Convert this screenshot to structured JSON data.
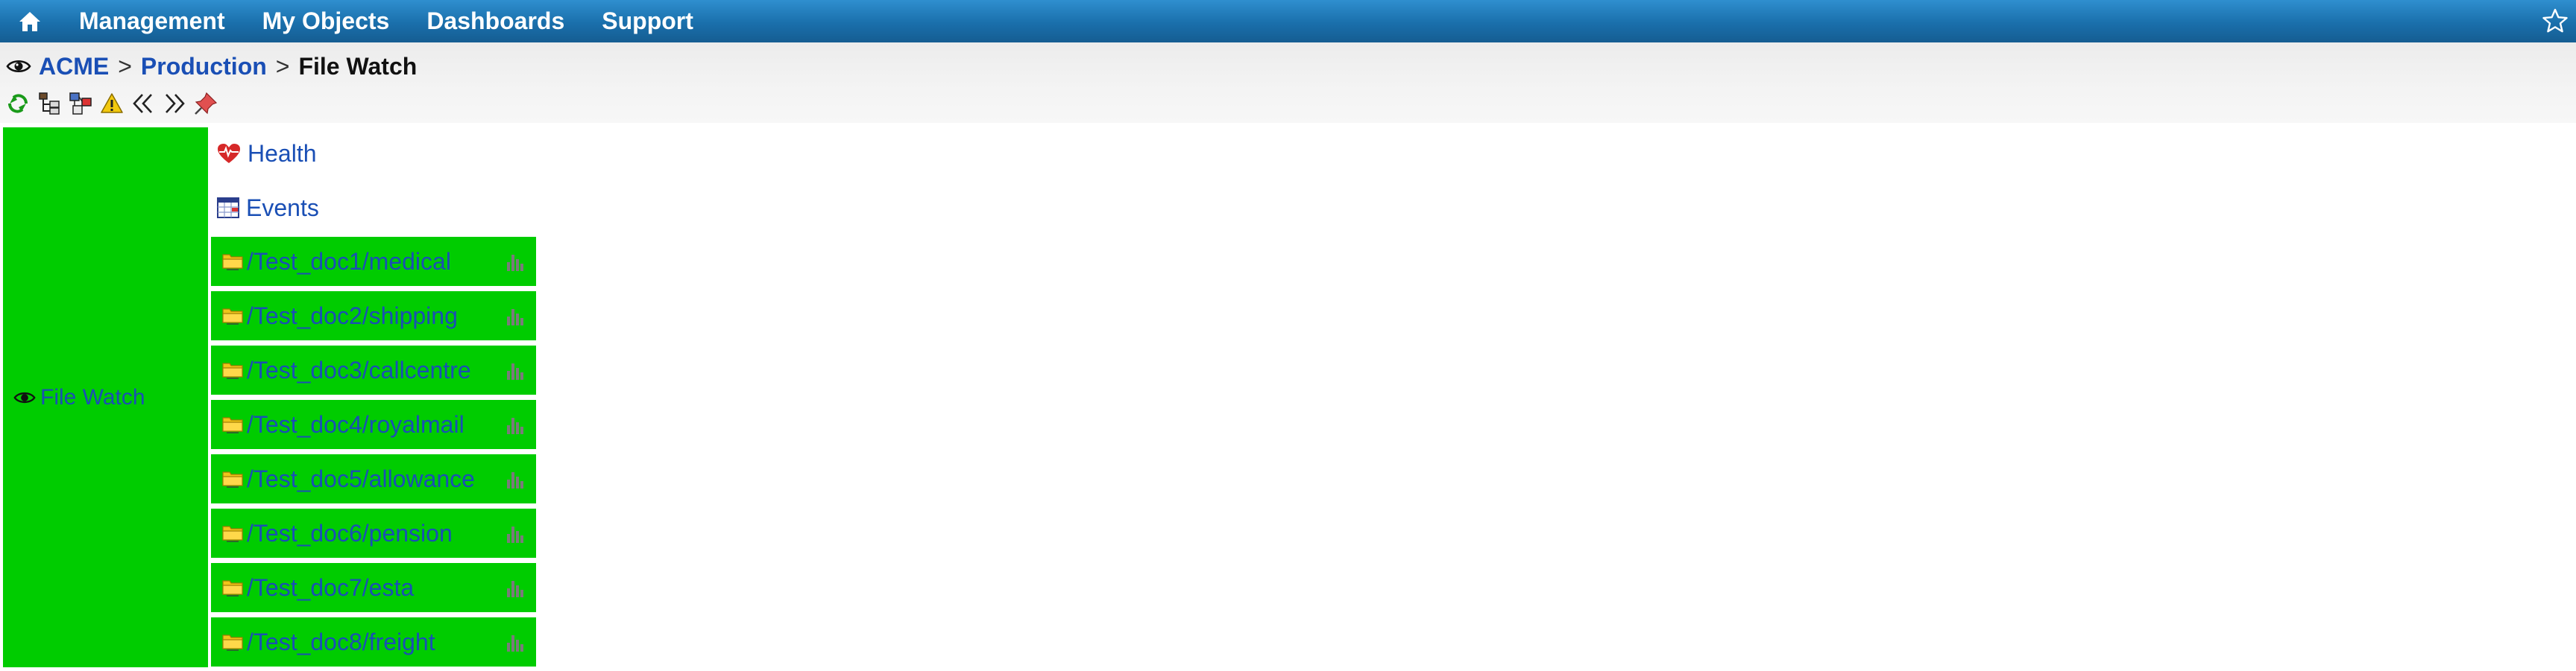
{
  "navbar": {
    "items": [
      {
        "label": "Management"
      },
      {
        "label": "My Objects"
      },
      {
        "label": "Dashboards"
      },
      {
        "label": "Support"
      }
    ]
  },
  "breadcrumb": {
    "items": [
      "ACME",
      "Production"
    ],
    "current": "File Watch",
    "separator": ">"
  },
  "toolbar": {
    "icons": [
      "refresh-icon",
      "tree-icon",
      "hierarchy-icon",
      "warning-icon",
      "back-icon",
      "forward-icon",
      "pin-icon"
    ]
  },
  "content": {
    "group_label": "File Watch",
    "health_label": "Health",
    "events_label": "Events",
    "directories": [
      {
        "path": "/Test_doc1/medical"
      },
      {
        "path": "/Test_doc2/shipping"
      },
      {
        "path": "/Test_doc3/callcentre"
      },
      {
        "path": "/Test_doc4/royalmail"
      },
      {
        "path": "/Test_doc5/allowance"
      },
      {
        "path": "/Test_doc6/pension"
      },
      {
        "path": "/Test_doc7/esta"
      },
      {
        "path": "/Test_doc8/freight"
      }
    ]
  },
  "colors": {
    "navbar": "#1a6fab",
    "status_ok": "#00cc00",
    "link": "#1a4fb5"
  }
}
